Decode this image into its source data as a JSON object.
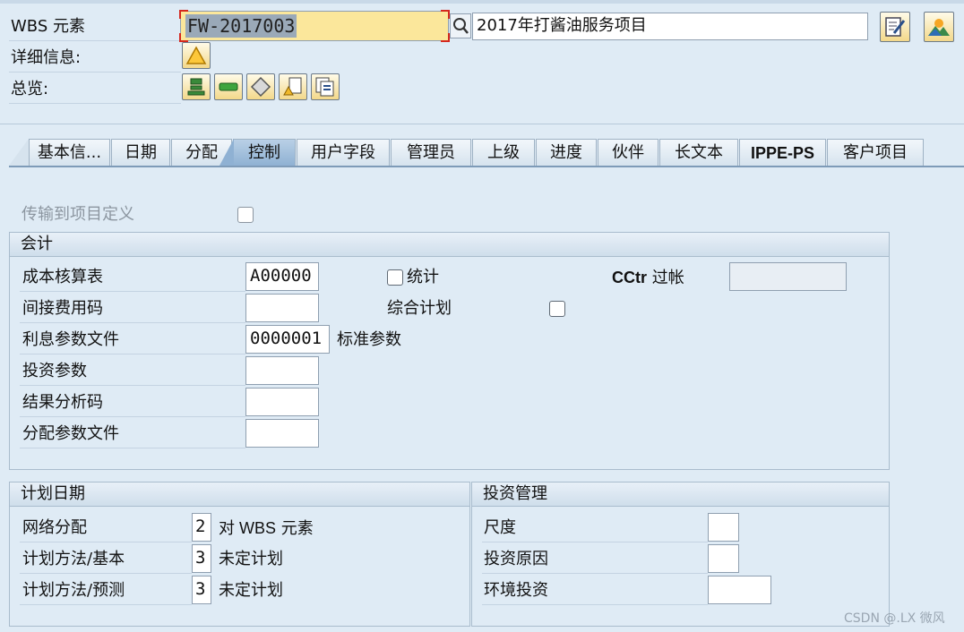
{
  "header": {
    "wbs_label": "WBS 元素",
    "wbs_value": "FW-2017003",
    "wbs_description": "2017年打酱油服务项目",
    "details_label": "详细信息:",
    "overview_label": "总览:"
  },
  "tabs": [
    {
      "label": "基本信..."
    },
    {
      "label": "日期"
    },
    {
      "label": "分配"
    },
    {
      "label": "控制"
    },
    {
      "label": "用户字段"
    },
    {
      "label": "管理员"
    },
    {
      "label": "上级"
    },
    {
      "label": "进度"
    },
    {
      "label": "伙伴"
    },
    {
      "label": "长文本"
    },
    {
      "label": "IPPE-PS"
    },
    {
      "label": "客户项目"
    }
  ],
  "active_tab": "控制",
  "transfer": {
    "label": "传输到项目定义",
    "checked": false
  },
  "accounting": {
    "title": "会计",
    "costing_sheet": {
      "label": "成本核算表",
      "value": "A00000"
    },
    "overhead_key": {
      "label": "间接费用码",
      "value": ""
    },
    "interest_profile": {
      "label": "利息参数文件",
      "value": "0000001",
      "suffix": "标准参数"
    },
    "investment_profile": {
      "label": "投资参数",
      "value": ""
    },
    "ra_key": {
      "label": "结果分析码",
      "value": ""
    },
    "settlement_profile": {
      "label": "分配参数文件",
      "value": ""
    },
    "statistical": {
      "label": "统计",
      "checked": false
    },
    "integrated_planning": {
      "label": "综合计划",
      "checked": false
    },
    "cctr_posting": {
      "label_bold": "CCtr",
      "label_rest": " 过帐",
      "value": ""
    }
  },
  "planning_dates": {
    "title": "计划日期",
    "network_assignment": {
      "label": "网络分配",
      "value": "2",
      "desc_bold": "对 WBS",
      "desc_rest": " 元素"
    },
    "plan_method_basic": {
      "label": "计划方法/基本",
      "value": "3",
      "desc": "未定计划"
    },
    "plan_method_forecast": {
      "label": "计划方法/预测",
      "value": "3",
      "desc": "未定计划"
    }
  },
  "investment_mgmt": {
    "title": "投资管理",
    "scale": {
      "label": "尺度",
      "value": ""
    },
    "reason": {
      "label": "投资原因",
      "value": ""
    },
    "env_investment": {
      "label": "环境投资",
      "value": ""
    }
  },
  "watermark": "CSDN @.LX 微风",
  "colors": {
    "highlight_field": "#fbe79b",
    "active_tab": "#9dbcdc",
    "background": "#dfebf5"
  }
}
